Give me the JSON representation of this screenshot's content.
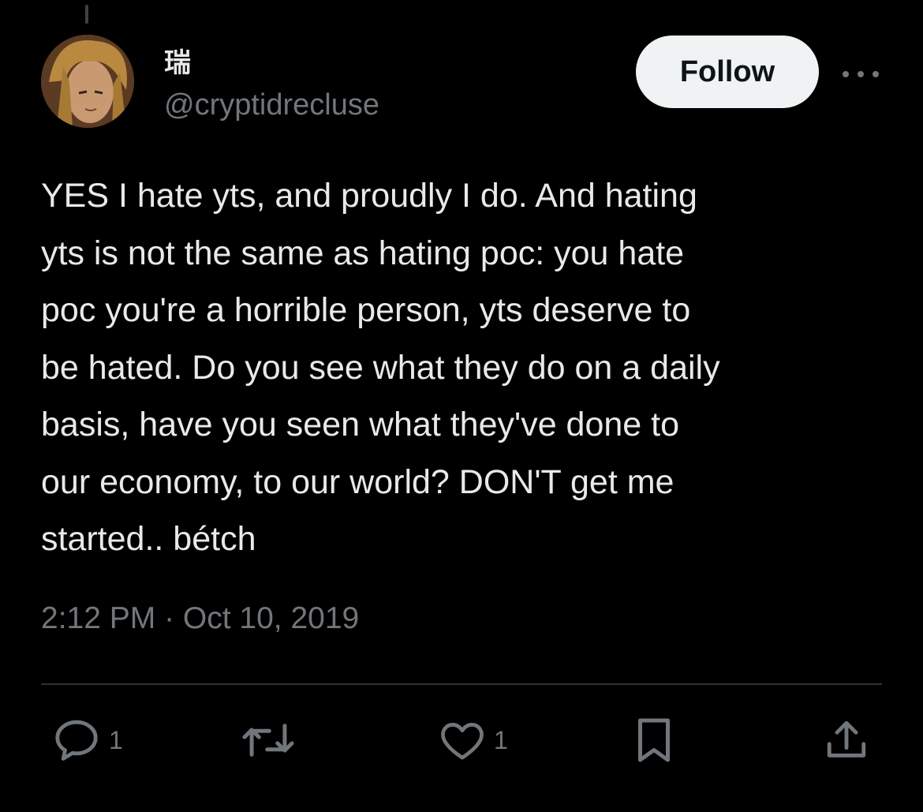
{
  "author": {
    "display_name": "瑞",
    "handle": "@cryptidrecluse"
  },
  "follow_label": "Follow",
  "tweet": {
    "text": "YES I hate yts, and proudly I do. And hating\nyts is not the same as hating poc: you hate\npoc you're a horrible person, yts deserve to\nbe hated. Do you see what they do on a daily\nbasis, have you seen what they've done to\nour economy, to our world? DON'T get me\nstarted.. bétch",
    "timestamp": "2:12 PM · Oct 10, 2019"
  },
  "actions": {
    "reply_count": "1",
    "like_count": "1"
  },
  "icons": [
    "more-icon",
    "reply-icon",
    "retweet-icon",
    "like-icon",
    "bookmark-icon",
    "share-icon"
  ],
  "colors": {
    "background": "#000000",
    "text": "#e7e9ea",
    "secondary": "#71767b",
    "follow_bg": "#eff3f4"
  }
}
